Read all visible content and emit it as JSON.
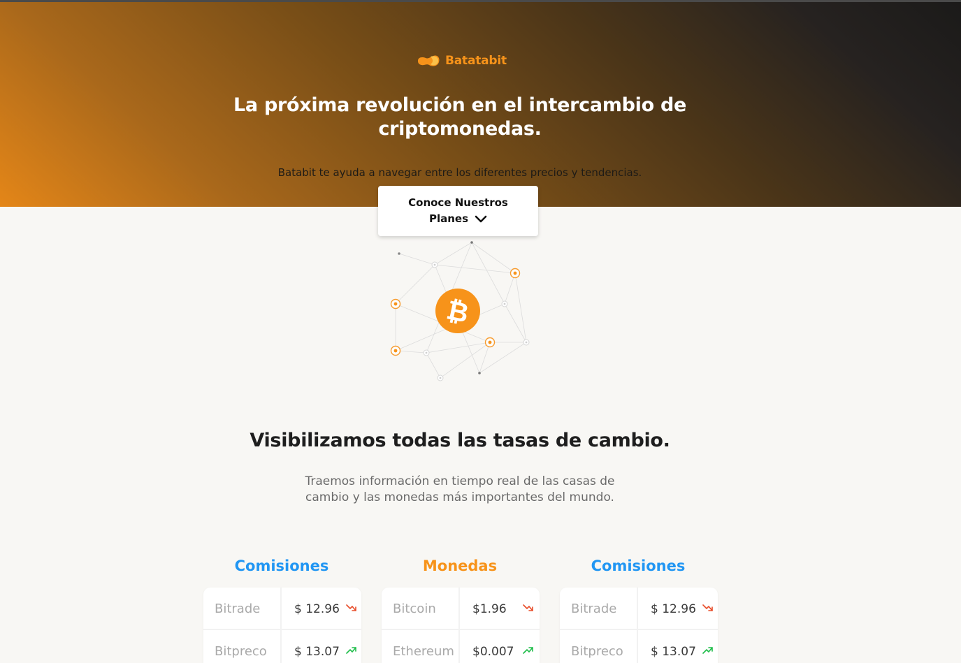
{
  "brand": {
    "name": "Batatabit",
    "color": "#f7931a",
    "icon": "potato-logo-icon"
  },
  "hero": {
    "title": "La próxima revolución en el intercambio de criptomonedas.",
    "subtitle": "Batabit te ayuda a navegar entre los diferentes precios y tendencias.",
    "cta_line1": "Conoce Nuestros",
    "cta_line2": "Planes",
    "cta_icon": "chevron-down-icon"
  },
  "illustration": {
    "icon": "bitcoin-icon",
    "symbol": "₿"
  },
  "rates": {
    "title": "Visibilizamos todas las tasas de cambio.",
    "subtitle": "Traemos información en tiempo real de las casas de cambio y las monedas más importantes del mundo.",
    "columns": [
      {
        "title": "Comisiones",
        "color": "#2196f3",
        "rows": [
          {
            "name": "Bitrade",
            "value": "$ 12.96",
            "trend": "down"
          },
          {
            "name": "Bitpreco",
            "value": "$ 13.07",
            "trend": "up"
          }
        ]
      },
      {
        "title": "Monedas",
        "color": "#f7931a",
        "rows": [
          {
            "name": "Bitcoin",
            "value": "$1.96",
            "trend": "down"
          },
          {
            "name": "Ethereum",
            "value": "$0.007",
            "trend": "up"
          }
        ]
      },
      {
        "title": "Comisiones",
        "color": "#2196f3",
        "rows": [
          {
            "name": "Bitrade",
            "value": "$ 12.96",
            "trend": "down"
          },
          {
            "name": "Bitpreco",
            "value": "$ 13.07",
            "trend": "up"
          }
        ]
      }
    ],
    "trend_colors": {
      "down": "#e84d2a",
      "up": "#1fbd4a"
    }
  }
}
